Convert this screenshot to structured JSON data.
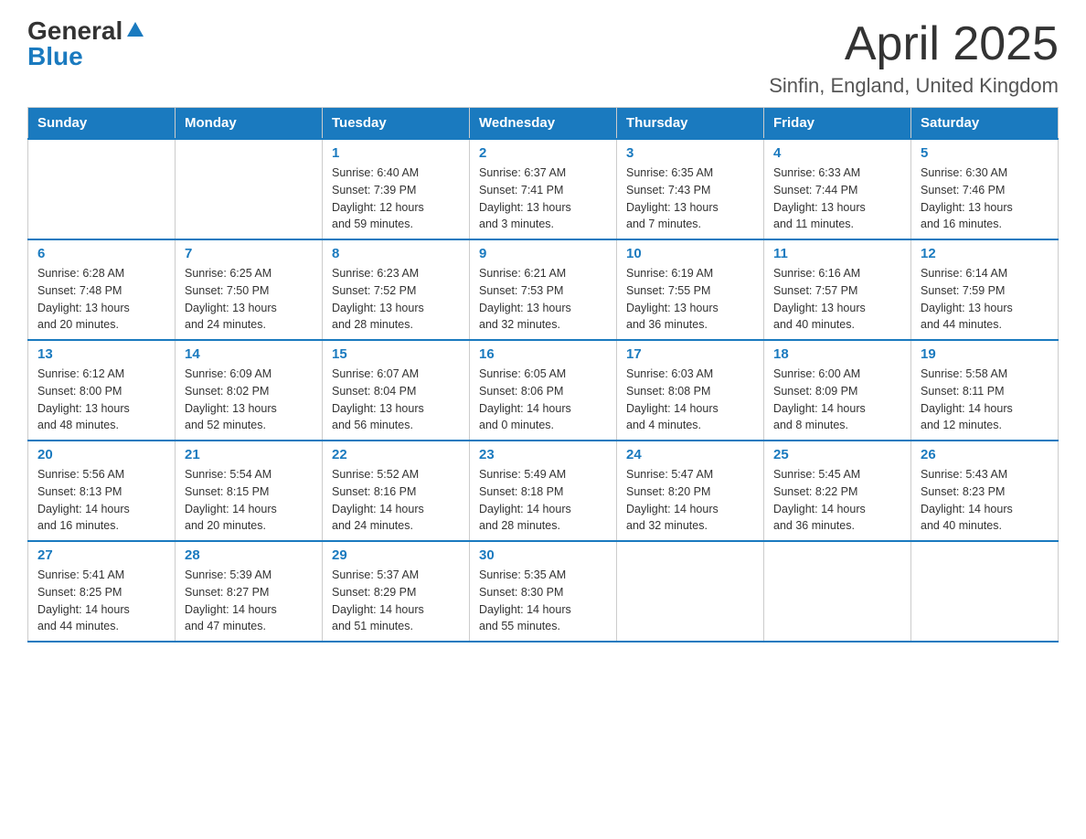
{
  "logo": {
    "general": "General",
    "blue": "Blue"
  },
  "title": "April 2025",
  "location": "Sinfin, England, United Kingdom",
  "days_of_week": [
    "Sunday",
    "Monday",
    "Tuesday",
    "Wednesday",
    "Thursday",
    "Friday",
    "Saturday"
  ],
  "weeks": [
    [
      {
        "day": "",
        "info": ""
      },
      {
        "day": "",
        "info": ""
      },
      {
        "day": "1",
        "info": "Sunrise: 6:40 AM\nSunset: 7:39 PM\nDaylight: 12 hours\nand 59 minutes."
      },
      {
        "day": "2",
        "info": "Sunrise: 6:37 AM\nSunset: 7:41 PM\nDaylight: 13 hours\nand 3 minutes."
      },
      {
        "day": "3",
        "info": "Sunrise: 6:35 AM\nSunset: 7:43 PM\nDaylight: 13 hours\nand 7 minutes."
      },
      {
        "day": "4",
        "info": "Sunrise: 6:33 AM\nSunset: 7:44 PM\nDaylight: 13 hours\nand 11 minutes."
      },
      {
        "day": "5",
        "info": "Sunrise: 6:30 AM\nSunset: 7:46 PM\nDaylight: 13 hours\nand 16 minutes."
      }
    ],
    [
      {
        "day": "6",
        "info": "Sunrise: 6:28 AM\nSunset: 7:48 PM\nDaylight: 13 hours\nand 20 minutes."
      },
      {
        "day": "7",
        "info": "Sunrise: 6:25 AM\nSunset: 7:50 PM\nDaylight: 13 hours\nand 24 minutes."
      },
      {
        "day": "8",
        "info": "Sunrise: 6:23 AM\nSunset: 7:52 PM\nDaylight: 13 hours\nand 28 minutes."
      },
      {
        "day": "9",
        "info": "Sunrise: 6:21 AM\nSunset: 7:53 PM\nDaylight: 13 hours\nand 32 minutes."
      },
      {
        "day": "10",
        "info": "Sunrise: 6:19 AM\nSunset: 7:55 PM\nDaylight: 13 hours\nand 36 minutes."
      },
      {
        "day": "11",
        "info": "Sunrise: 6:16 AM\nSunset: 7:57 PM\nDaylight: 13 hours\nand 40 minutes."
      },
      {
        "day": "12",
        "info": "Sunrise: 6:14 AM\nSunset: 7:59 PM\nDaylight: 13 hours\nand 44 minutes."
      }
    ],
    [
      {
        "day": "13",
        "info": "Sunrise: 6:12 AM\nSunset: 8:00 PM\nDaylight: 13 hours\nand 48 minutes."
      },
      {
        "day": "14",
        "info": "Sunrise: 6:09 AM\nSunset: 8:02 PM\nDaylight: 13 hours\nand 52 minutes."
      },
      {
        "day": "15",
        "info": "Sunrise: 6:07 AM\nSunset: 8:04 PM\nDaylight: 13 hours\nand 56 minutes."
      },
      {
        "day": "16",
        "info": "Sunrise: 6:05 AM\nSunset: 8:06 PM\nDaylight: 14 hours\nand 0 minutes."
      },
      {
        "day": "17",
        "info": "Sunrise: 6:03 AM\nSunset: 8:08 PM\nDaylight: 14 hours\nand 4 minutes."
      },
      {
        "day": "18",
        "info": "Sunrise: 6:00 AM\nSunset: 8:09 PM\nDaylight: 14 hours\nand 8 minutes."
      },
      {
        "day": "19",
        "info": "Sunrise: 5:58 AM\nSunset: 8:11 PM\nDaylight: 14 hours\nand 12 minutes."
      }
    ],
    [
      {
        "day": "20",
        "info": "Sunrise: 5:56 AM\nSunset: 8:13 PM\nDaylight: 14 hours\nand 16 minutes."
      },
      {
        "day": "21",
        "info": "Sunrise: 5:54 AM\nSunset: 8:15 PM\nDaylight: 14 hours\nand 20 minutes."
      },
      {
        "day": "22",
        "info": "Sunrise: 5:52 AM\nSunset: 8:16 PM\nDaylight: 14 hours\nand 24 minutes."
      },
      {
        "day": "23",
        "info": "Sunrise: 5:49 AM\nSunset: 8:18 PM\nDaylight: 14 hours\nand 28 minutes."
      },
      {
        "day": "24",
        "info": "Sunrise: 5:47 AM\nSunset: 8:20 PM\nDaylight: 14 hours\nand 32 minutes."
      },
      {
        "day": "25",
        "info": "Sunrise: 5:45 AM\nSunset: 8:22 PM\nDaylight: 14 hours\nand 36 minutes."
      },
      {
        "day": "26",
        "info": "Sunrise: 5:43 AM\nSunset: 8:23 PM\nDaylight: 14 hours\nand 40 minutes."
      }
    ],
    [
      {
        "day": "27",
        "info": "Sunrise: 5:41 AM\nSunset: 8:25 PM\nDaylight: 14 hours\nand 44 minutes."
      },
      {
        "day": "28",
        "info": "Sunrise: 5:39 AM\nSunset: 8:27 PM\nDaylight: 14 hours\nand 47 minutes."
      },
      {
        "day": "29",
        "info": "Sunrise: 5:37 AM\nSunset: 8:29 PM\nDaylight: 14 hours\nand 51 minutes."
      },
      {
        "day": "30",
        "info": "Sunrise: 5:35 AM\nSunset: 8:30 PM\nDaylight: 14 hours\nand 55 minutes."
      },
      {
        "day": "",
        "info": ""
      },
      {
        "day": "",
        "info": ""
      },
      {
        "day": "",
        "info": ""
      }
    ]
  ]
}
